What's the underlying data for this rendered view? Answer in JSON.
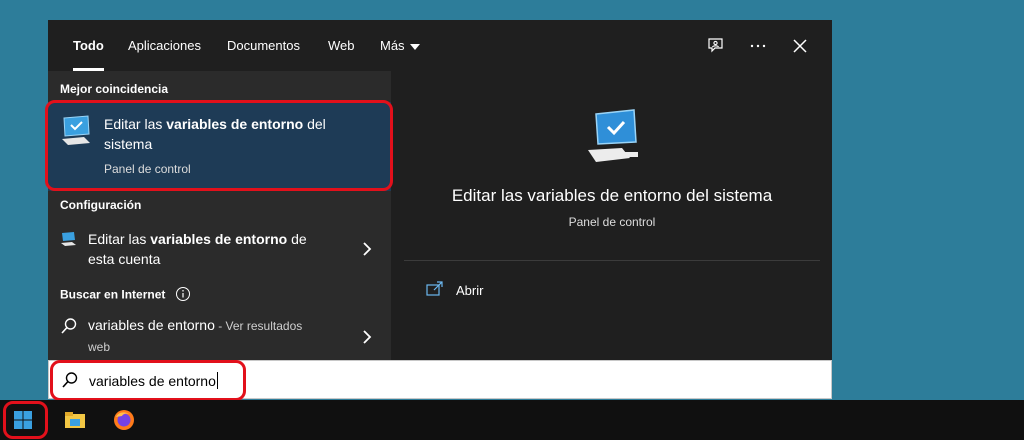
{
  "tabs": {
    "items": [
      {
        "label": "Todo",
        "active": true
      },
      {
        "label": "Aplicaciones"
      },
      {
        "label": "Documentos"
      },
      {
        "label": "Web"
      },
      {
        "label": "Más"
      }
    ],
    "icons": [
      "feedback-icon",
      "more-icon",
      "close-icon"
    ]
  },
  "sections": {
    "best_match": "Mejor coincidencia",
    "settings": "Configuración",
    "web": "Buscar en Internet"
  },
  "best_match_item": {
    "title_prefix": "Editar las ",
    "title_bold": "variables de entorno",
    "title_suffix": " del",
    "title_line2": "sistema",
    "subtitle": "Panel de control"
  },
  "settings_item": {
    "title_prefix": "Editar las ",
    "title_bold": "variables de entorno",
    "title_suffix": " de",
    "title_line2": "esta cuenta"
  },
  "web_item": {
    "query": "variables de entorno",
    "suffix": " - Ver resultados",
    "line2": "web"
  },
  "preview": {
    "title": "Editar las variables de entorno del sistema",
    "subtitle": "Panel de control",
    "action_open": "Abrir"
  },
  "search": {
    "value": "variables de entorno"
  },
  "colors": {
    "desktop": "#2d7d9a",
    "panel": "#1f1f1f",
    "selected": "#1e3b56",
    "highlight": "#e2101b"
  }
}
